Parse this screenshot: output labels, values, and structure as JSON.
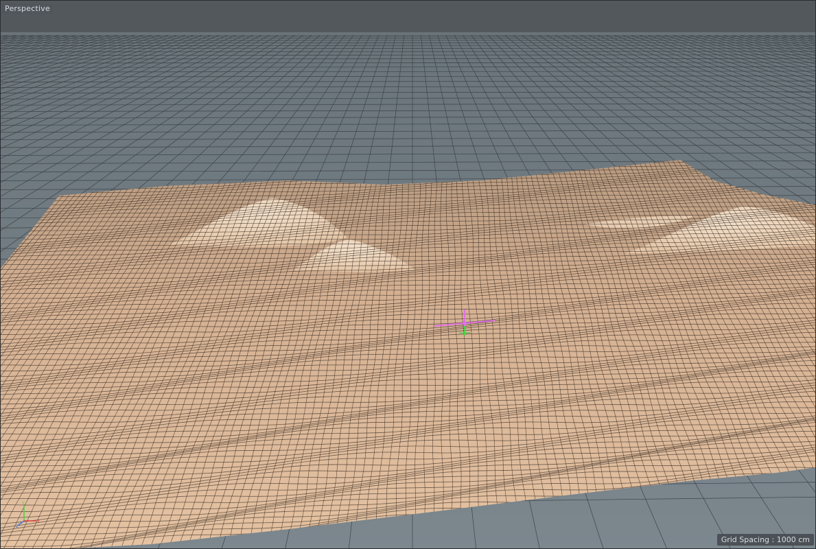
{
  "viewport": {
    "view_name": "Perspective",
    "grid_spacing": "Grid Spacing : 1000 cm"
  },
  "colors": {
    "background": "#4e5357",
    "sky": "#52585c",
    "floor": "#77838a",
    "floor_grid_line": "#3c4348",
    "terrain_fill": "#d9b597",
    "terrain_highlight": "#f2dcc6",
    "terrain_wire": "#2b2119",
    "axis_x": "#e0403a",
    "axis_y": "#4fd04a",
    "axis_z": "#3f78e8",
    "pivot_gizmo": "#e070e6"
  },
  "icons": {
    "world_axis": "xyz-axis-icon",
    "object_pivot": "object-pivot-icon"
  }
}
